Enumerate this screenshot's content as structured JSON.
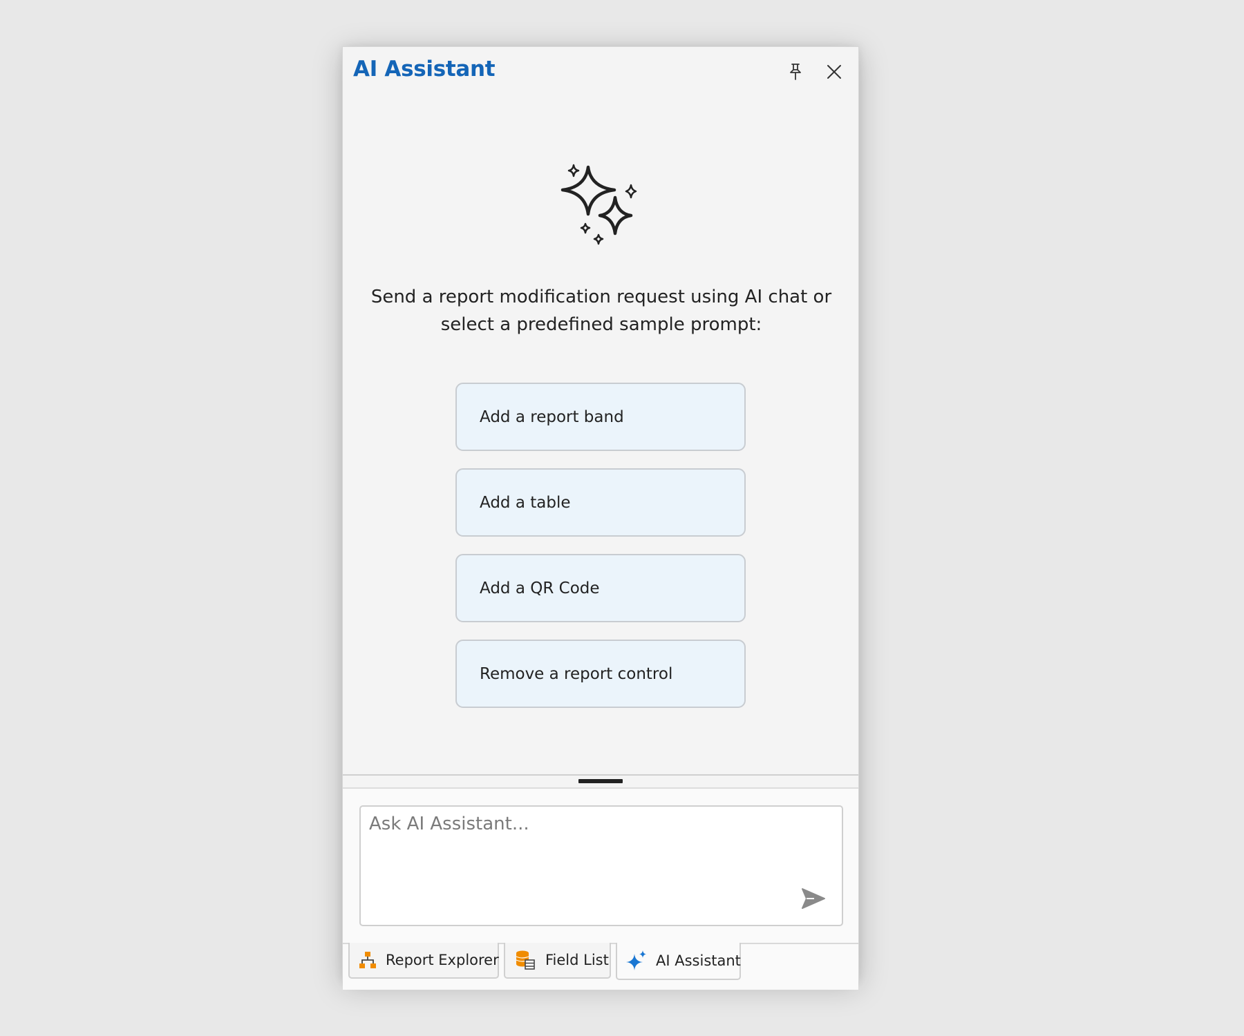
{
  "panel": {
    "title": "AI Assistant"
  },
  "header": {
    "pin_icon": "pin-icon",
    "close_icon": "close-icon"
  },
  "welcome": {
    "icon": "sparkles-icon",
    "message_line1": "Send a report modification request using AI chat or",
    "message_line2": "select a predefined sample prompt:"
  },
  "prompts": [
    {
      "label": "Add a report band"
    },
    {
      "label": "Add a table"
    },
    {
      "label": "Add a QR Code"
    },
    {
      "label": "Remove a report control"
    }
  ],
  "input": {
    "placeholder": "Ask AI Assistant...",
    "value": "",
    "send_icon": "send-icon"
  },
  "tabs": [
    {
      "label": "Report Explorer",
      "icon": "report-explorer-icon",
      "active": false
    },
    {
      "label": "Field List",
      "icon": "field-list-icon",
      "active": false
    },
    {
      "label": "AI Assistant",
      "icon": "ai-sparkle-icon",
      "active": true
    }
  ],
  "colors": {
    "accent": "#1465b7",
    "prompt_bg": "#ebf4fb",
    "tab_icon_orange": "#f08c00",
    "ai_icon_blue": "#1976d2"
  }
}
